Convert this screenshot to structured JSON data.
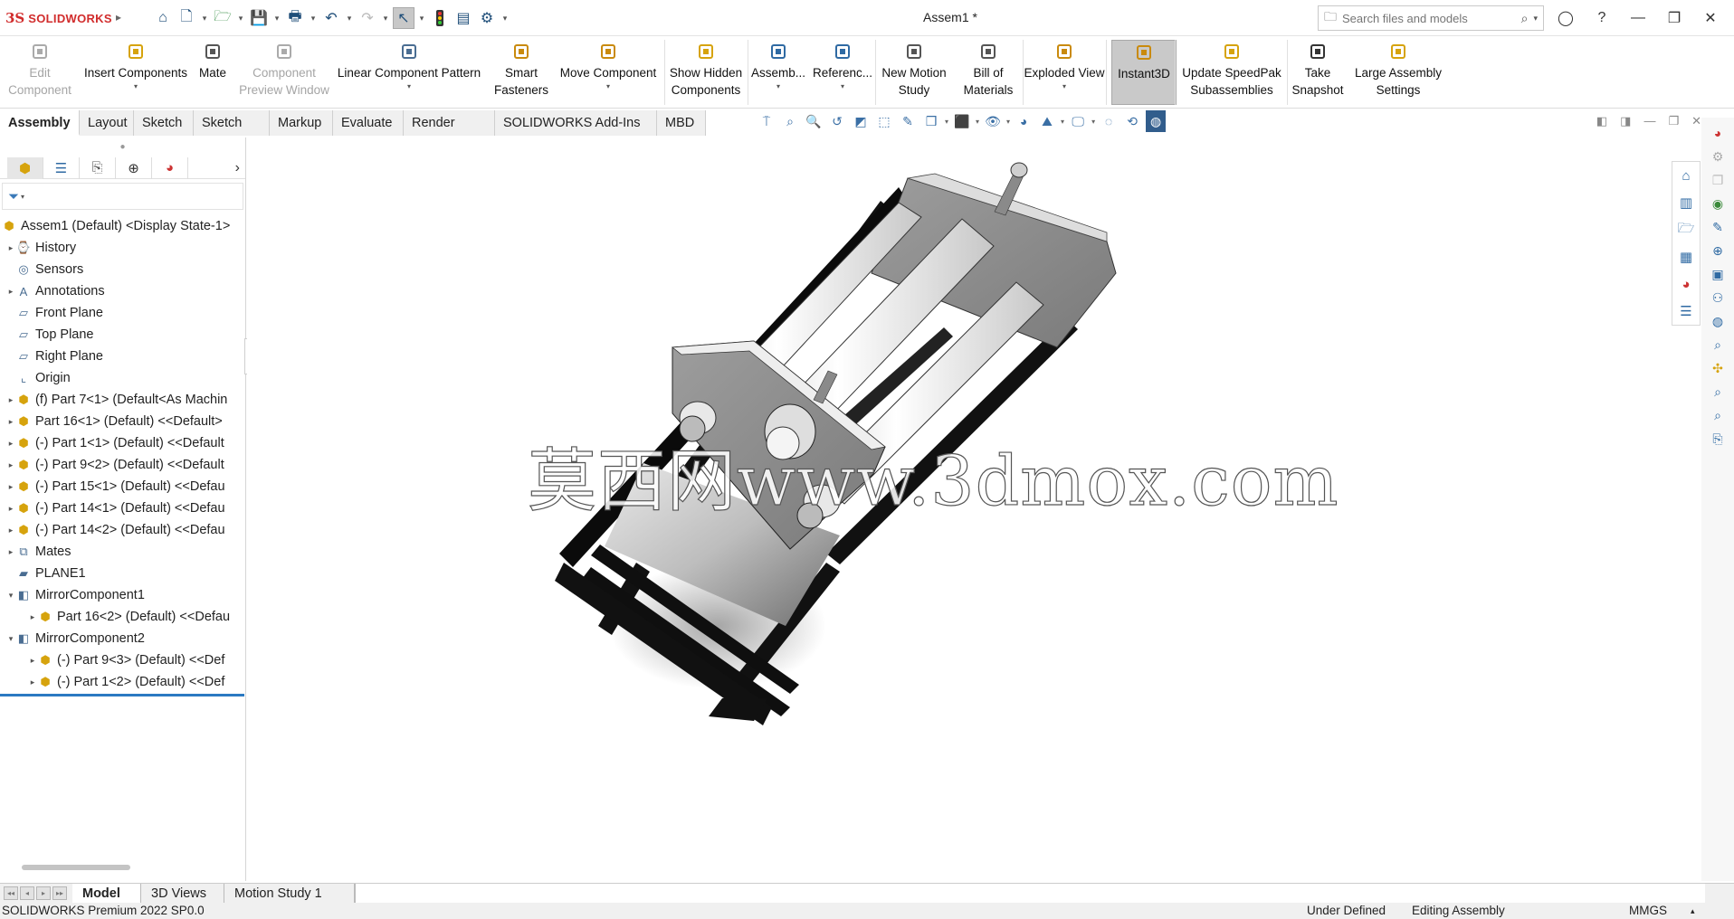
{
  "app": {
    "logo_ds": "3S",
    "logo_name": "SOLIDWORKS",
    "document_title": "Assem1 *"
  },
  "search": {
    "placeholder": "Search files and models"
  },
  "ribbon": {
    "buttons": [
      {
        "label": "Edit\nComponent",
        "state": "disabled",
        "icon": "edit-component-icon"
      },
      {
        "label": "Insert Components",
        "state": "normal",
        "icon": "insert-components-icon"
      },
      {
        "label": "Mate",
        "state": "normal",
        "icon": "mate-icon"
      },
      {
        "label": "Component\nPreview Window",
        "state": "disabled",
        "icon": "preview-window-icon"
      },
      {
        "label": "Linear Component Pattern",
        "state": "normal",
        "icon": "linear-pattern-icon"
      },
      {
        "label": "Smart\nFasteners",
        "state": "normal",
        "icon": "smart-fasteners-icon"
      },
      {
        "label": "Move Component",
        "state": "normal",
        "icon": "move-component-icon"
      },
      {
        "label": "Show Hidden\nComponents",
        "state": "normal",
        "icon": "show-hidden-icon"
      },
      {
        "label": "Assemb...",
        "state": "normal",
        "icon": "assembly-features-icon"
      },
      {
        "label": "Referenc...",
        "state": "normal",
        "icon": "reference-geometry-icon"
      },
      {
        "label": "New Motion\nStudy",
        "state": "normal",
        "icon": "motion-study-icon"
      },
      {
        "label": "Bill of\nMaterials",
        "state": "normal",
        "icon": "bill-of-materials-icon"
      },
      {
        "label": "Exploded View",
        "state": "normal",
        "icon": "exploded-view-icon"
      },
      {
        "label": "Instant3D",
        "state": "active",
        "icon": "instant3d-icon"
      },
      {
        "label": "Update SpeedPak\nSubassemblies",
        "state": "normal",
        "icon": "speedpak-icon"
      },
      {
        "label": "Take\nSnapshot",
        "state": "normal",
        "icon": "snapshot-icon"
      },
      {
        "label": "Large Assembly\nSettings",
        "state": "normal",
        "icon": "large-assembly-icon"
      }
    ]
  },
  "tabs": [
    "Assembly",
    "Layout",
    "Sketch",
    "Sketch Ink",
    "Markup",
    "Evaluate",
    "Render Tools",
    "SOLIDWORKS Add-Ins",
    "MBD"
  ],
  "active_tab": "Assembly",
  "tree": {
    "root": "Assem1 (Default) <Display State-1>",
    "items": [
      {
        "label": "History",
        "icon": "history-icon",
        "expand": "closed",
        "indent": 0
      },
      {
        "label": "Sensors",
        "icon": "sensors-icon",
        "expand": "none",
        "indent": 0
      },
      {
        "label": "Annotations",
        "icon": "annotations-icon",
        "expand": "closed",
        "indent": 0
      },
      {
        "label": "Front Plane",
        "icon": "plane-icon",
        "expand": "none",
        "indent": 0
      },
      {
        "label": "Top Plane",
        "icon": "plane-icon",
        "expand": "none",
        "indent": 0
      },
      {
        "label": "Right Plane",
        "icon": "plane-icon",
        "expand": "none",
        "indent": 0
      },
      {
        "label": "Origin",
        "icon": "origin-icon",
        "expand": "none",
        "indent": 0
      },
      {
        "label": "(f) Part 7<1> (Default<As Machin",
        "icon": "part-icon",
        "expand": "closed",
        "indent": 0
      },
      {
        "label": "Part 16<1> (Default) <<Default>",
        "icon": "part-icon",
        "expand": "closed",
        "indent": 0
      },
      {
        "label": "(-) Part 1<1> (Default) <<Default",
        "icon": "part-icon",
        "expand": "closed",
        "indent": 0
      },
      {
        "label": "(-) Part 9<2> (Default) <<Default",
        "icon": "part-icon",
        "expand": "closed",
        "indent": 0
      },
      {
        "label": "(-) Part 15<1> (Default) <<Defau",
        "icon": "part-icon",
        "expand": "closed",
        "indent": 0
      },
      {
        "label": "(-) Part 14<1> (Default) <<Defau",
        "icon": "part-icon",
        "expand": "closed",
        "indent": 0
      },
      {
        "label": "(-) Part 14<2> (Default) <<Defau",
        "icon": "part-icon",
        "expand": "closed",
        "indent": 0
      },
      {
        "label": "Mates",
        "icon": "mates-icon",
        "expand": "closed",
        "indent": 0
      },
      {
        "label": "PLANE1",
        "icon": "plane1-icon",
        "expand": "none",
        "indent": 0
      },
      {
        "label": "MirrorComponent1",
        "icon": "mirror-component-icon",
        "expand": "open",
        "indent": 0
      },
      {
        "label": "Part 16<2> (Default) <<Defau",
        "icon": "part-icon",
        "expand": "closed",
        "indent": 1
      },
      {
        "label": "MirrorComponent2",
        "icon": "mirror-component-icon",
        "expand": "open",
        "indent": 0
      },
      {
        "label": "(-) Part 9<3> (Default) <<Def",
        "icon": "part-icon",
        "expand": "closed",
        "indent": 1
      },
      {
        "label": "(-) Part 1<2> (Default) <<Def",
        "icon": "part-icon",
        "expand": "closed",
        "indent": 1
      }
    ]
  },
  "viewport": {
    "watermark": "莫西网www.3dmox.com"
  },
  "bottom_tabs": [
    "Model",
    "3D Views",
    "Motion Study 1"
  ],
  "active_bottom_tab": "Model",
  "status": {
    "product": "SOLIDWORKS Premium 2022 SP0.0",
    "definition": "Under Defined",
    "mode": "Editing Assembly",
    "units": "MMGS"
  }
}
